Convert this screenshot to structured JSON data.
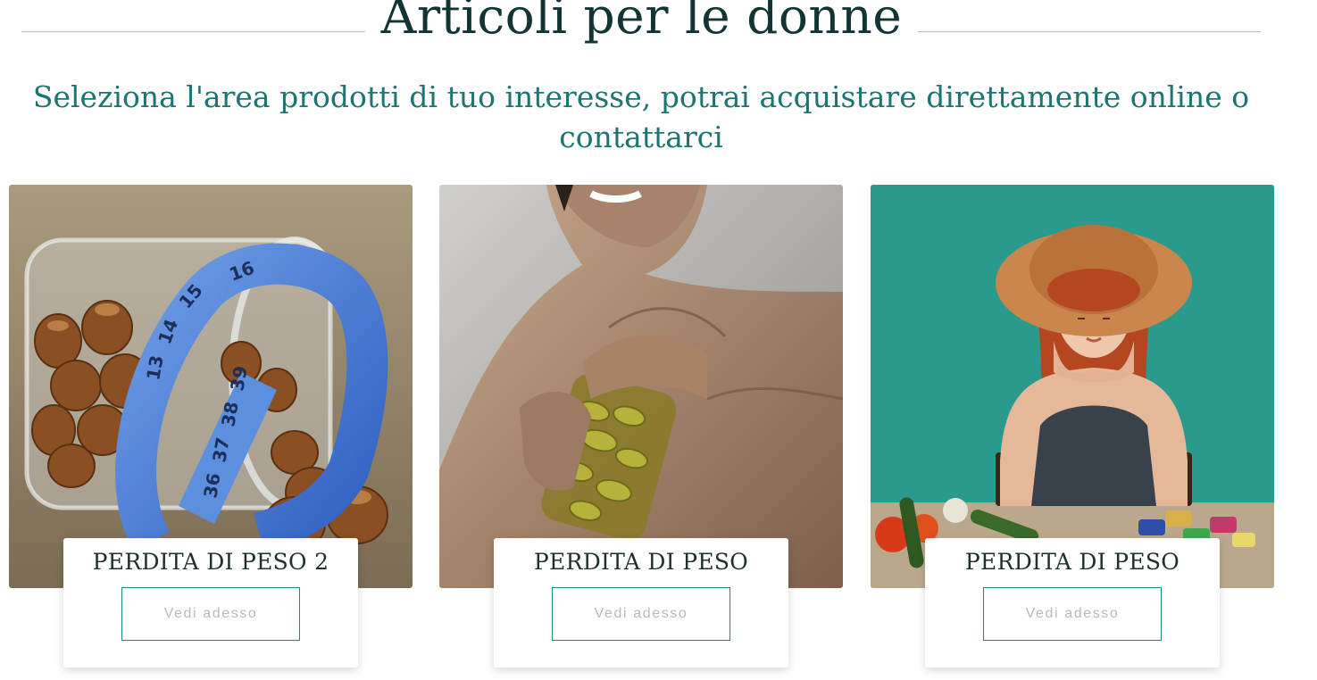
{
  "section": {
    "title": "Articoli per le donne",
    "subtitle": "Seleziona l'area prodotti di tuo interesse, potrai acquistare direttamente online o contattarci"
  },
  "cards": [
    {
      "title": "PERDITA DI PESO 2",
      "button_label": "Vedi adesso",
      "tape_numbers": [
        "16",
        "15",
        "14",
        "13",
        "39",
        "38",
        "37",
        "36"
      ]
    },
    {
      "title": "PERDITA DI PESO",
      "button_label": "Vedi adesso"
    },
    {
      "title": "PERDITA DI PESO",
      "button_label": "Vedi adesso"
    }
  ],
  "colors": {
    "accent": "#1f8a83",
    "heading": "#123534",
    "subtitle": "#1c7570",
    "rule": "#9ccfcb",
    "teal_backdrop": "#2a9a8d"
  }
}
